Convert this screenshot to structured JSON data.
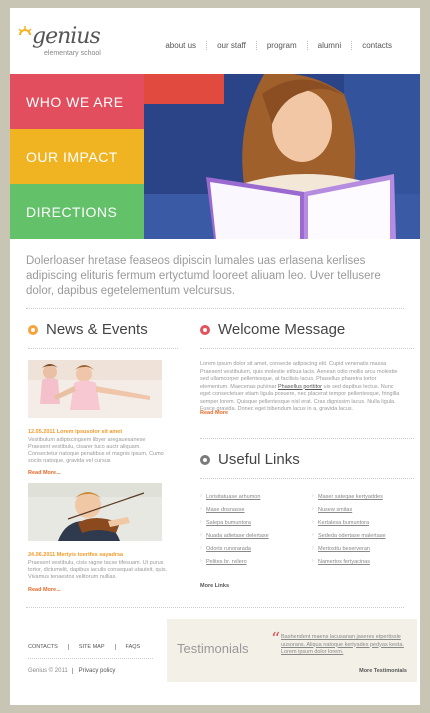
{
  "brand": {
    "name": "genius",
    "tagline": "elementary school"
  },
  "nav": [
    "about us",
    "our staff",
    "program",
    "alumni",
    "contacts"
  ],
  "hero": {
    "tiles": [
      "WHO WE ARE",
      "OUR IMPACT",
      "DIRECTIONS"
    ]
  },
  "intro": "Dolerloaser hretase feaseos dipiscin lumales uas erlasena kerlises adipiscing elituris fermum ertyctumd looreet aliuam leo. Uver tellusere dolor, dapibus egetelementum velcursus.",
  "news": {
    "title": "News & Events",
    "items": [
      {
        "date": "12.05.2011 ",
        "headline": "Lorem ipsusolor sit amet",
        "body": "Vestibulum adipiscingsem libyer aregauesanese Praesent vestibulu, cisarer tuco auctr aliquam. Consectetur natoque penatibus et magnis ipsum, Cumo sociis natoque, gravida vel cursus",
        "readmore": "Read More..."
      },
      {
        "date": "24.06.2011 ",
        "headline": "Mertyis toertfes sayadrsa",
        "body": "Praesent vestibulu, cisis ragne tacse tifesuam. Ut purus tortor, dictumelit, dapibus iaculis consequat utauteit, quis. Vivamus tenaestos velitorum nullias.",
        "readmore": "Read More..."
      }
    ]
  },
  "welcome": {
    "title": "Welcome Message",
    "body_before": "Lorem ipsum dolor sit amet, consecte adipiscing elit. Cupid venenatis massa Praesent vestibulum, quis molestie etibua lacis. Aenean odio mollis arcu molestie sed ullamcorper pellentesque, at facilisis lacus. Phasellus pharetra tortor elementum. Maecenas pulvinar ",
    "highlight": "Phasellus porttitor",
    "body_after": " uis sed dapibus lectus. Nunc eget consectetuer etiam ligula posuere, nec placerat tempor pellentesque, fringilla semper lorem. Quisque pellentesque nisl erat. Cras dignissim lacus. Nulla ligula. Fusce gravida. Donec eget bibendum lacus in a, gravida lacus.",
    "readmore": "Read More"
  },
  "links": {
    "title": "Useful Links",
    "col1": [
      "Lorisitatuase arhumon",
      "Mase dosnasse",
      "Salepa bumuntora",
      "Nuada adietase delertase",
      "Odorts runorarada",
      "Pelites br. rvilero"
    ],
    "col2": [
      "Maser sateqae kertyaddes",
      "Nusew smitas",
      "Kertalesa bumuntora",
      "Sededa odertase malertase",
      "Mertosttu beserveran",
      "Namertos fertyacinas"
    ],
    "more": "More Links"
  },
  "footer": {
    "nav": [
      "CONTACTS",
      "SITE MAP",
      "FAQS"
    ],
    "copyright": "Genius © 2011",
    "privacy": "Privacy policy"
  },
  "testimonials": {
    "title": "Testimonials",
    "quote": "Bashendent maens lacusanan jaseres etpertissle uusorans. Aliqua natoque kertyades pedyas kesta. Lorem ipsum dolor lorem.",
    "more": "More Testimonials"
  },
  "colors": {
    "red": "#e24e5e",
    "yellow": "#f0b423",
    "green": "#62c169",
    "orange": "#f39a2a"
  }
}
